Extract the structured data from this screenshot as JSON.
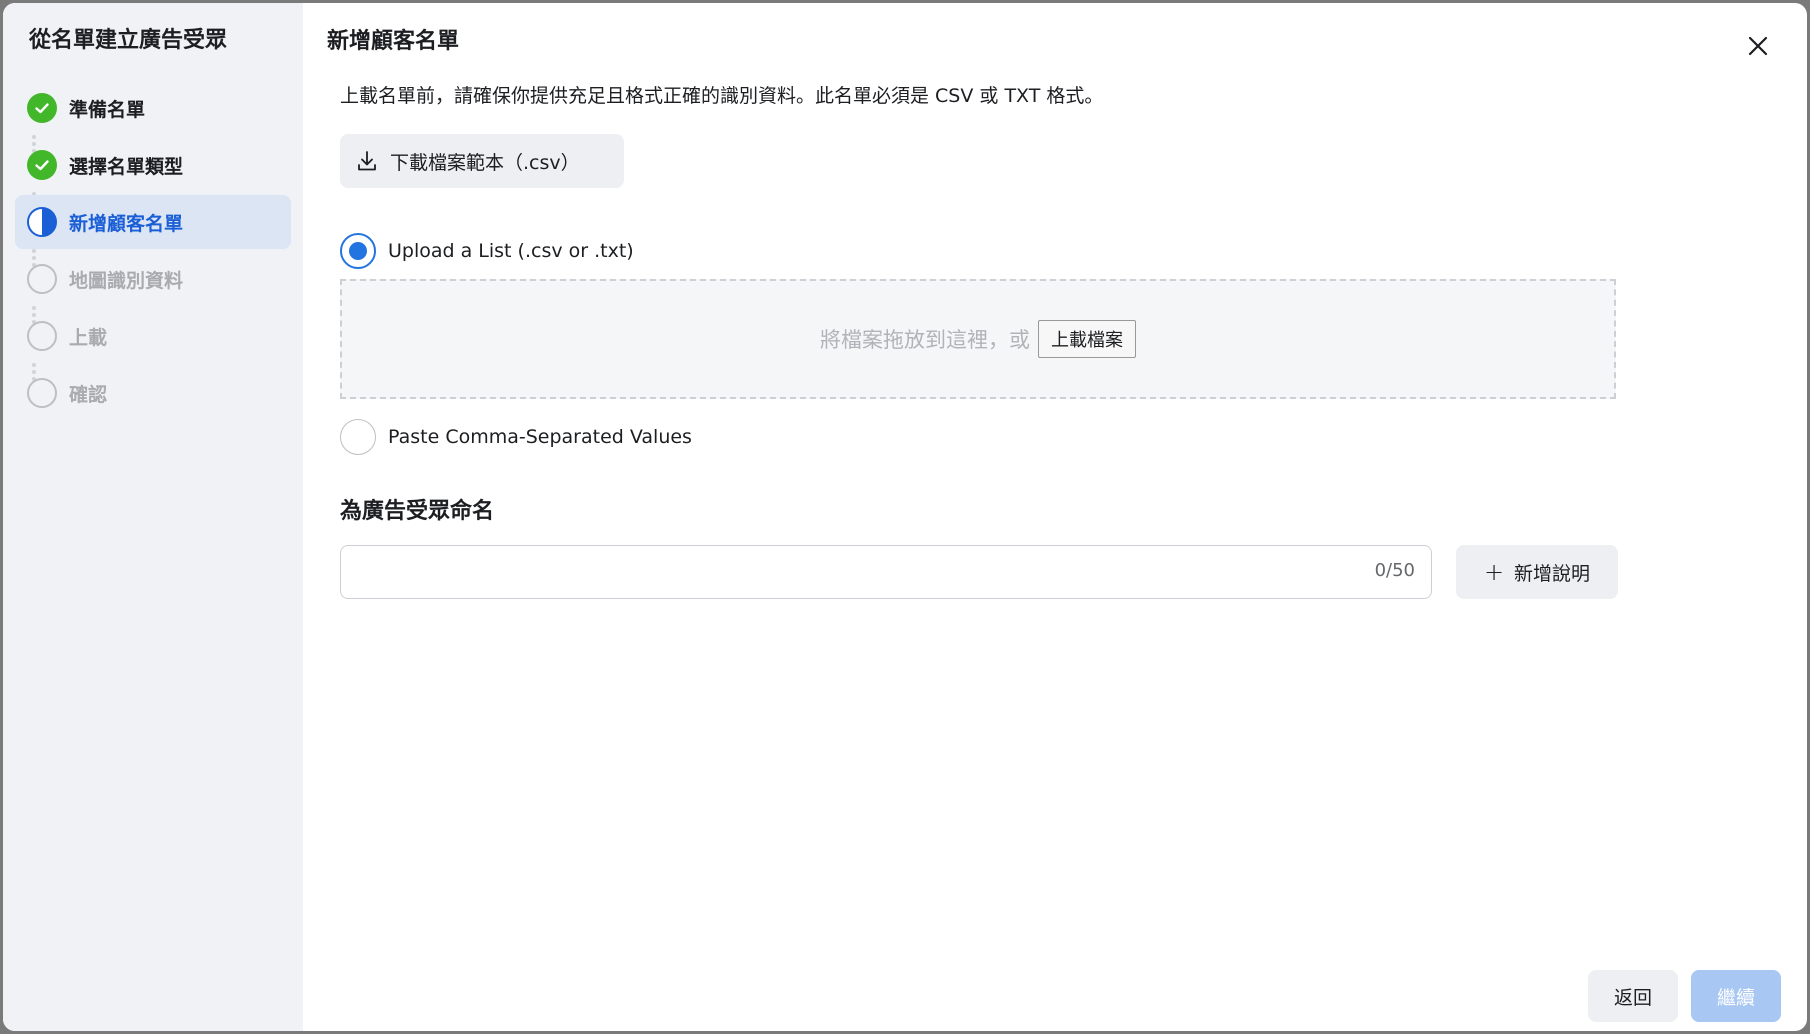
{
  "sidebar": {
    "title": "從名單建立廣告受眾",
    "steps": [
      {
        "label": "準備名單",
        "state": "done"
      },
      {
        "label": "選擇名單類型",
        "state": "done"
      },
      {
        "label": "新增顧客名單",
        "state": "active"
      },
      {
        "label": "地圖識別資料",
        "state": "todo"
      },
      {
        "label": "上載",
        "state": "todo"
      },
      {
        "label": "確認",
        "state": "todo"
      }
    ]
  },
  "main": {
    "title": "新增顧客名單",
    "instructions": "上載名單前，請確保你提供充足且格式正確的識別資料。此名單必須是 CSV 或 TXT 格式。",
    "download_label": "下載檔案範本（.csv）",
    "radio_upload_label": "Upload a List (.csv or .txt)",
    "dropzone_text": "將檔案拖放到這裡，或",
    "upload_file_label": "上載檔案",
    "radio_paste_label": "Paste Comma-Separated Values",
    "name_section_label": "為廣告受眾命名",
    "name_input_value": "",
    "char_count": "0/50",
    "add_description_label": "新增說明"
  },
  "footer": {
    "back_label": "返回",
    "continue_label": "繼續"
  },
  "colors": {
    "done": "#42b72a",
    "active": "#1b5fd6",
    "accent": "#2374e1",
    "disabled_primary": "#a9c7f3"
  }
}
